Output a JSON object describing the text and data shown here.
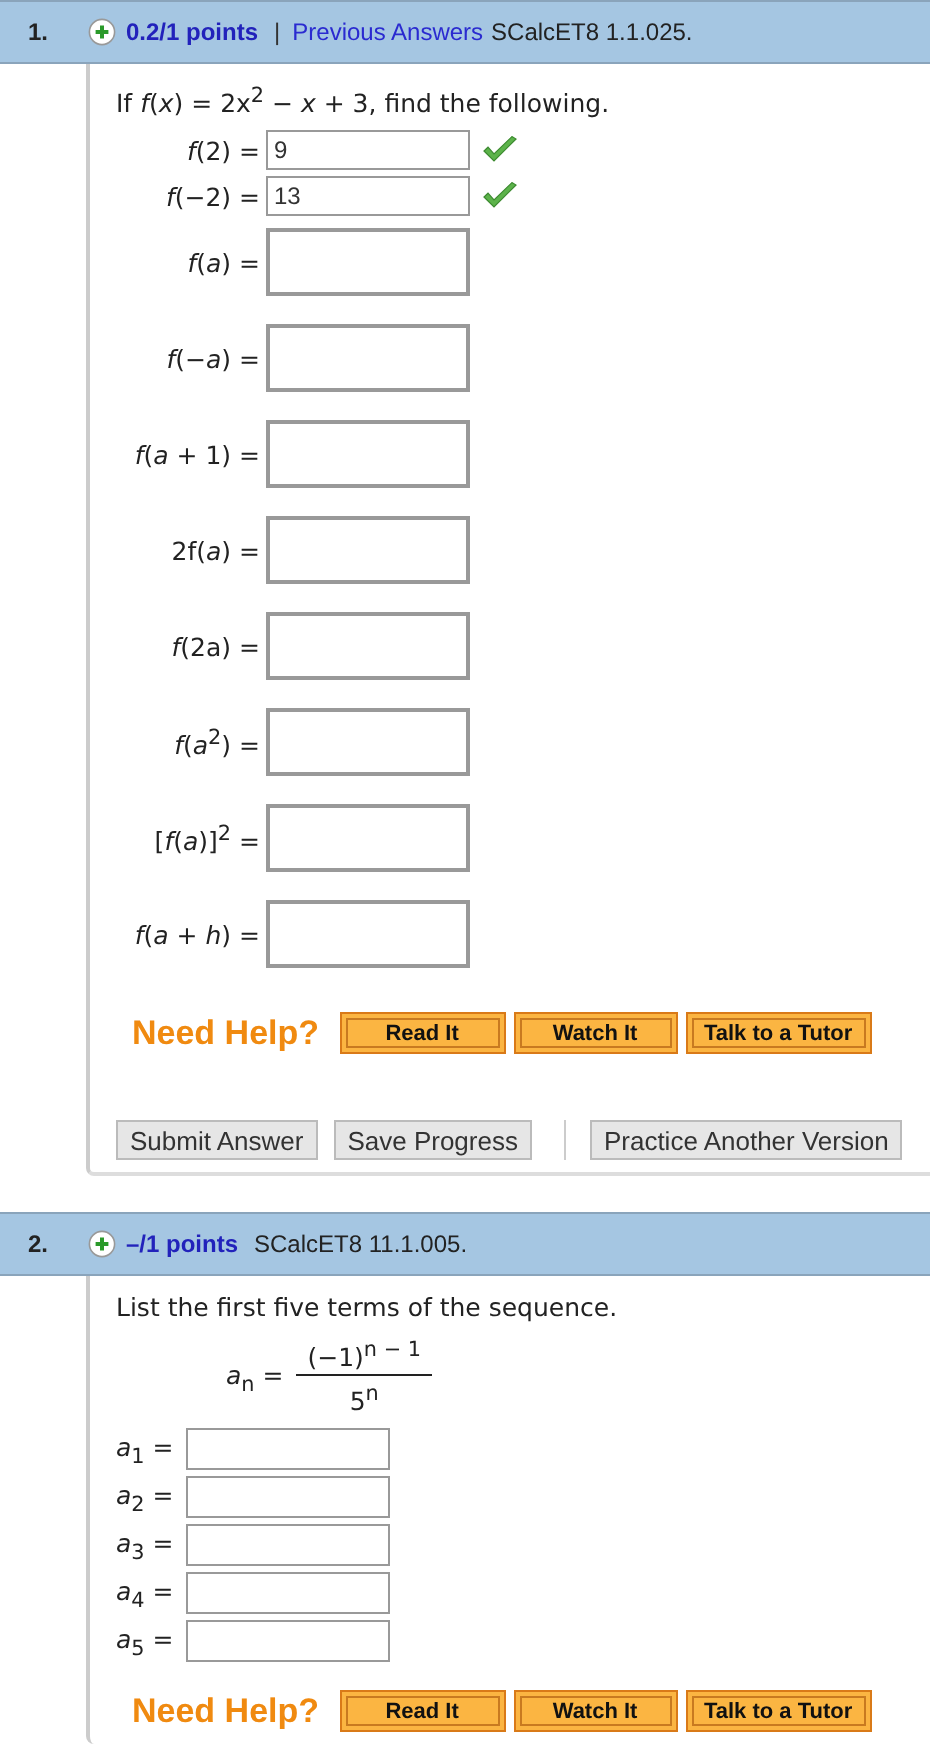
{
  "questions": [
    {
      "number": "1.",
      "points": "0.2/1 points",
      "separator": "|",
      "link": "Previous Answers",
      "source": "SCalcET8 1.1.025.",
      "prompt": "If *f*(*x*) = 2x$^{2}$ − *x* + 3,  find the following.",
      "answers": [
        {
          "kind": "short",
          "label": "*f*(2) =",
          "value": "9",
          "correct": true
        },
        {
          "kind": "short",
          "label": "*f*(−2)  =",
          "value": "13",
          "correct": true
        },
        {
          "kind": "tall",
          "label": "*f*(*a*) =",
          "correct": false
        },
        {
          "kind": "tall",
          "label": "*f*(−*a*) =",
          "correct": false
        },
        {
          "kind": "tall",
          "label": "*f*(*a* + 1) =",
          "correct": false
        },
        {
          "kind": "tall",
          "label": "2f(*a*) =",
          "correct": false
        },
        {
          "kind": "tall",
          "label": "*f*(2a) =",
          "correct": false
        },
        {
          "kind": "tall",
          "label": "*f*(*a*$^{2}$) =",
          "correct": false
        },
        {
          "kind": "tall",
          "label": "[*f*(*a*)]$^{2}$ =",
          "correct": false
        },
        {
          "kind": "tall",
          "label": "*f*(*a* + *h*) =",
          "correct": false
        }
      ],
      "help": {
        "title": "Need Help?",
        "buttons": [
          "Read It",
          "Watch It",
          "Talk to a Tutor"
        ]
      },
      "actions": [
        "Submit Answer",
        "Save Progress"
      ],
      "extra_actions": [
        "Practice Another Version"
      ]
    },
    {
      "number": "2.",
      "points": "–/1 points",
      "source": "SCalcET8 11.1.005.",
      "prompt": "List the first five terms of the sequence.",
      "formula": {
        "lhs": "*a*$_{n}$ =",
        "numerator": "(−1)$^{n − 1}$",
        "denominator": "5$^{n}$"
      },
      "answers": [
        {
          "kind": "indexed",
          "label": "*a*$_{1}$ =",
          "correct": false
        },
        {
          "kind": "indexed",
          "label": "*a*$_{2}$ =",
          "correct": false
        },
        {
          "kind": "indexed",
          "label": "*a*$_{3}$ =",
          "correct": false
        },
        {
          "kind": "indexed",
          "label": "*a*$_{4}$ =",
          "correct": false
        },
        {
          "kind": "indexed",
          "label": "*a*$_{5}$ =",
          "correct": false
        }
      ],
      "help": {
        "title": "Need Help?",
        "buttons": [
          "Read It",
          "Watch It",
          "Talk to a Tutor"
        ]
      }
    }
  ]
}
